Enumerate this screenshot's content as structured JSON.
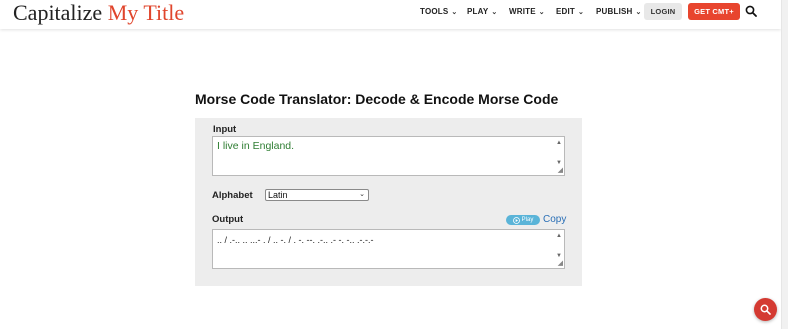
{
  "header": {
    "logo_part1": "Capitalize ",
    "logo_part2": "My Title",
    "nav": [
      {
        "label": "TOOLS"
      },
      {
        "label": "PLAY"
      },
      {
        "label": "WRITE"
      },
      {
        "label": "EDIT"
      },
      {
        "label": "PUBLISH"
      }
    ],
    "login_label": "LOGIN",
    "getcmt_label": "GET CMT+"
  },
  "main": {
    "title": "Morse Code Translator: Decode & Encode Morse Code",
    "input_label": "Input",
    "input_value": "I live in England.",
    "alphabet_label": "Alphabet",
    "alphabet_selected": "Latin",
    "output_label": "Output",
    "play_label": "Play",
    "copy_label": "Copy",
    "output_value": ".. / .-.. .. ...- . / .. -. / . -. --. .-.. .- -. -.. .-.-.-"
  },
  "colors": {
    "accent": "#e0452c",
    "input_text": "#2e7d32",
    "play_button": "#5ab4d8",
    "fab": "#d43a32"
  }
}
